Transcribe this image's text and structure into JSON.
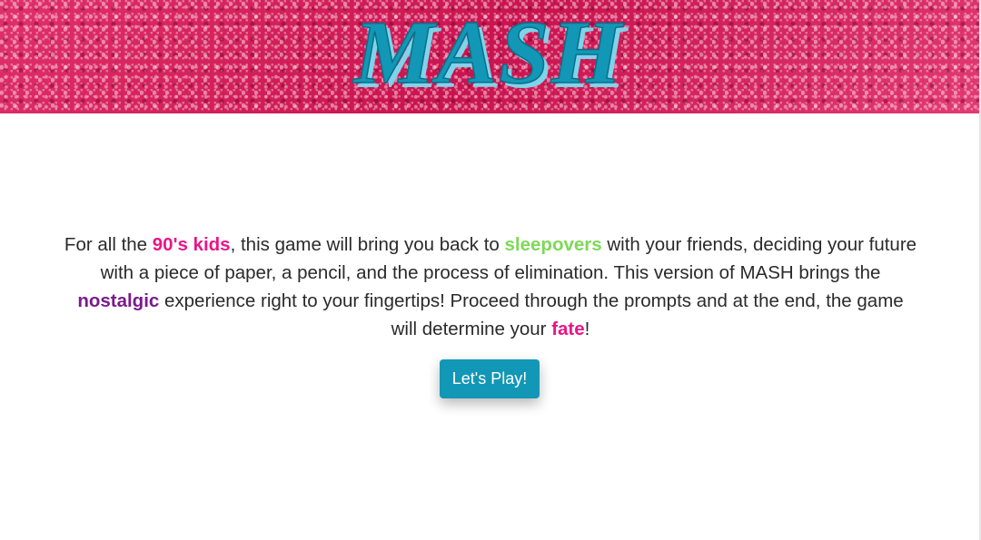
{
  "header": {
    "logo_text": "MASH",
    "colors": {
      "banner": "#d81e5b",
      "logo_fill": "#1297b6",
      "logo_shadow": "#7fd3ea"
    }
  },
  "intro": {
    "part1": "For all the ",
    "highlight_kids": "90's kids",
    "part2": ", this game will bring you back to ",
    "highlight_sleepovers": "sleepovers",
    "part3": " with your friends, deciding your future with a piece of paper, a pencil, and the process of elimination. This version of MASH brings the ",
    "highlight_nostalgic": "nostalgic",
    "part4": " experience right to your fingertips! Proceed through the prompts and at the end, the game will determine your ",
    "highlight_fate": "fate",
    "part5": "!",
    "colors": {
      "pink": "#e8168a",
      "green": "#7ed957",
      "purple": "#7a1a8c"
    }
  },
  "play_button": {
    "label": "Let's Play!",
    "color": "#1297b6"
  }
}
